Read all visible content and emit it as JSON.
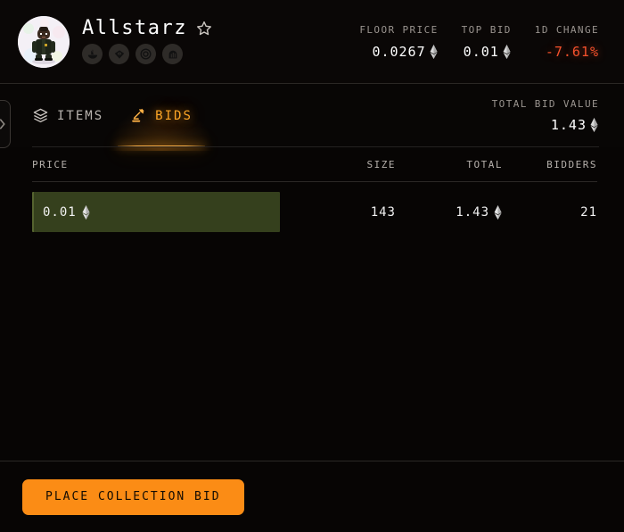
{
  "header": {
    "collection_name": "Allstarz",
    "favorite_icon": "star-icon",
    "avatar_icon": "collection-avatar",
    "socials": [
      {
        "name": "opensea-icon",
        "label": "OpenSea"
      },
      {
        "name": "blur-icon",
        "label": "Blur"
      },
      {
        "name": "magiceden-icon",
        "label": "Magic Eden"
      },
      {
        "name": "stats-icon",
        "label": "Stats"
      }
    ],
    "stats": [
      {
        "name": "floor-price",
        "label": "FLOOR PRICE",
        "value": "0.0267",
        "currency": "ETH",
        "negative": false
      },
      {
        "name": "top-bid",
        "label": "TOP BID",
        "value": "0.01",
        "currency": "ETH",
        "negative": false
      },
      {
        "name": "one-day-change",
        "label": "1D CHANGE",
        "value": "-7.61%",
        "currency": "",
        "negative": true
      }
    ]
  },
  "side_handle": {
    "icon": "chevron-right-icon"
  },
  "tabs": [
    {
      "name": "tab-items",
      "label": "ITEMS",
      "icon": "layers-icon",
      "active": false
    },
    {
      "name": "tab-bids",
      "label": "BIDS",
      "icon": "gavel-icon",
      "active": true
    }
  ],
  "total_bid": {
    "label": "TOTAL BID VALUE",
    "value": "1.43",
    "currency": "ETH"
  },
  "table": {
    "columns": [
      {
        "name": "column-price",
        "label": "PRICE"
      },
      {
        "name": "column-size",
        "label": "SIZE"
      },
      {
        "name": "column-total",
        "label": "TOTAL"
      },
      {
        "name": "column-bidders",
        "label": "BIDDERS"
      }
    ],
    "rows": [
      {
        "price": "0.01",
        "price_currency": "ETH",
        "size": "143",
        "total": "1.43",
        "total_currency": "ETH",
        "bidders": "21",
        "depth_pct": 100
      }
    ]
  },
  "footer": {
    "place_bid_label": "PLACE COLLECTION BID"
  },
  "colors": {
    "background": "#070504",
    "accent": "#fb8c15",
    "tab_active": "#ffa726",
    "negative": "#f4512c",
    "depth_bar": "#35401d",
    "depth_bar_edge": "#55632f",
    "text_primary": "#ffffff",
    "text_muted": "#9a948f"
  }
}
